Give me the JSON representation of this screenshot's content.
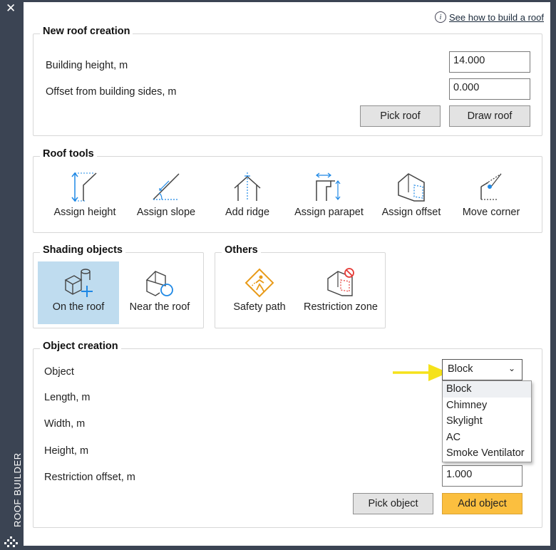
{
  "panel": {
    "close_symbol": "✕",
    "vertical_title": "ROOF BUILDER"
  },
  "help": {
    "icon": "info-icon",
    "link_text": "See how to build a roof"
  },
  "new_roof": {
    "title": "New roof creation",
    "building_height_label": "Building height, m",
    "building_height_value": "14.000",
    "offset_label": "Offset from building sides, m",
    "offset_value": "0.000",
    "pick_roof": "Pick roof",
    "draw_roof": "Draw roof"
  },
  "roof_tools": {
    "title": "Roof tools",
    "items": [
      {
        "label": "Assign height",
        "icon": "assign-height-icon"
      },
      {
        "label": "Assign slope",
        "icon": "assign-slope-icon"
      },
      {
        "label": "Add ridge",
        "icon": "add-ridge-icon"
      },
      {
        "label": "Assign parapet",
        "icon": "assign-parapet-icon"
      },
      {
        "label": "Assign offset",
        "icon": "assign-offset-icon"
      },
      {
        "label": "Move corner",
        "icon": "move-corner-icon"
      }
    ]
  },
  "shading": {
    "title": "Shading objects",
    "items": [
      {
        "label": "On the roof",
        "icon": "on-roof-icon",
        "selected": true
      },
      {
        "label": "Near the roof",
        "icon": "near-roof-icon",
        "selected": false
      }
    ]
  },
  "others": {
    "title": "Others",
    "items": [
      {
        "label": "Safety path",
        "icon": "safety-path-icon"
      },
      {
        "label": "Restriction zone",
        "icon": "restriction-zone-icon"
      }
    ]
  },
  "object_creation": {
    "title": "Object creation",
    "object_label": "Object",
    "object_selected": "Block",
    "options": [
      "Block",
      "Chimney",
      "Skylight",
      "AC",
      "Smoke Ventilator"
    ],
    "length_label": "Length, m",
    "width_label": "Width, m",
    "height_label": "Height, m",
    "restriction_label": "Restriction offset, m",
    "restriction_value": "1.000",
    "pick_object": "Pick object",
    "add_object": "Add object"
  },
  "colors": {
    "accent": "#fbbf3f",
    "selected_bg": "#bfdcef",
    "icon_blue": "#1e88e5",
    "annotation_arrow": "#f5e21a",
    "sidebar": "#3b4453"
  }
}
